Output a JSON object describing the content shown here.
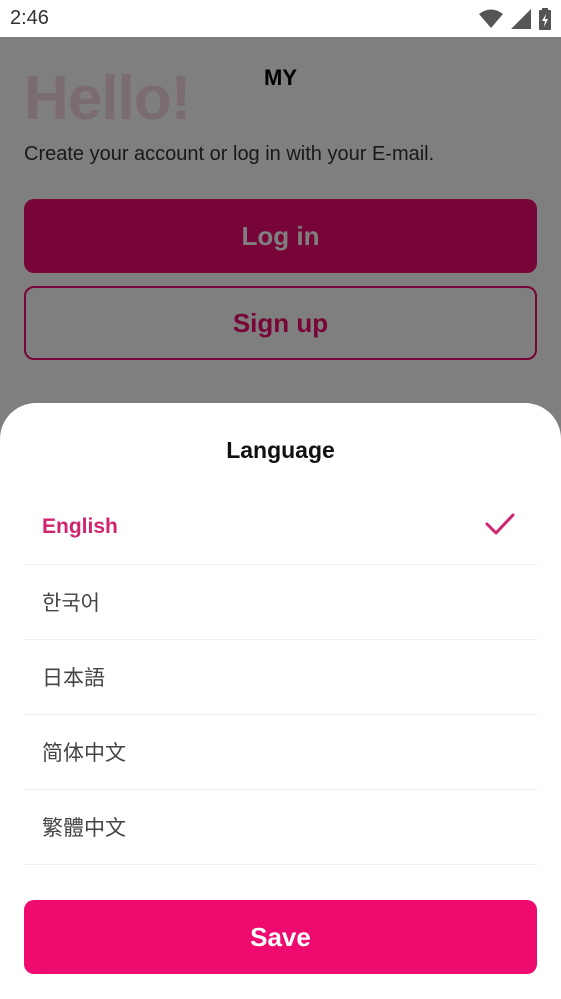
{
  "status_bar": {
    "time": "2:46",
    "icons": [
      "wifi-icon",
      "signal-icon",
      "battery-icon"
    ]
  },
  "background": {
    "header_title": "MY",
    "greeting": "Hello!",
    "subtitle": "Create your account or log in with your E-mail.",
    "login_label": "Log in",
    "signup_label": "Sign up"
  },
  "sheet": {
    "title": "Language",
    "languages": [
      {
        "label": "English",
        "selected": true
      },
      {
        "label": "한국어",
        "selected": false
      },
      {
        "label": "日本語",
        "selected": false
      },
      {
        "label": "简体中文",
        "selected": false
      },
      {
        "label": "繁體中文",
        "selected": false
      }
    ],
    "save_label": "Save"
  },
  "colors": {
    "accent": "#ee0a6e",
    "selected_text": "#d1246f",
    "overlay": "rgba(0,0,0,0.5)"
  }
}
